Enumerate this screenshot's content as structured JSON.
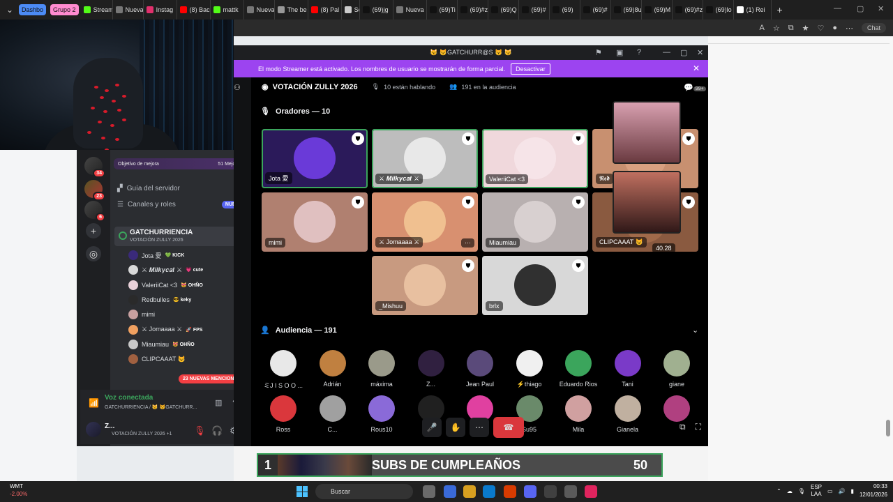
{
  "browser": {
    "tabs": [
      {
        "label": "Dashbo",
        "color": "#4c8bf5",
        "group": true
      },
      {
        "label": "Grupo 2",
        "color": "#ff8bd0",
        "group": true
      },
      {
        "label": "Stream",
        "color": "#53fc18"
      },
      {
        "label": "Nueva",
        "color": "#777777"
      },
      {
        "label": "Instag",
        "color": "#e1306c"
      },
      {
        "label": "(8) Bac",
        "color": "#ff0000"
      },
      {
        "label": "mattk",
        "color": "#53fc18"
      },
      {
        "label": "Nueva",
        "color": "#777777"
      },
      {
        "label": "The be",
        "color": "#999999"
      },
      {
        "label": "(8) Pal",
        "color": "#ff0000"
      },
      {
        "label": "Sc",
        "color": "#cccccc"
      },
      {
        "label": "(69)jg",
        "color": "#111111"
      },
      {
        "label": "Nueva",
        "color": "#777777"
      },
      {
        "label": "(69)Ti",
        "color": "#111111"
      },
      {
        "label": "(69)#z",
        "color": "#111111"
      },
      {
        "label": "(69)Q",
        "color": "#111111"
      },
      {
        "label": "(69)#",
        "color": "#111111"
      },
      {
        "label": "(69)",
        "color": "#111111"
      },
      {
        "label": "(69)#",
        "color": "#111111"
      },
      {
        "label": "(69)8u",
        "color": "#111111"
      },
      {
        "label": "(69)M",
        "color": "#111111"
      },
      {
        "label": "(69)#z",
        "color": "#111111"
      },
      {
        "label": "(69)lo",
        "color": "#111111"
      },
      {
        "label": "(1) Rei",
        "color": "#ffffff"
      }
    ],
    "chat_label": "Chat"
  },
  "sidebar": {
    "boost_label": "Objetivo de mejora",
    "boost_count": "51 Mejoras",
    "guild_badges": [
      "34",
      "23",
      "6"
    ],
    "channels": [
      {
        "label": "Guía del servidor",
        "icon": "guide-icon"
      },
      {
        "label": "Canales y roles",
        "icon": "list-icon",
        "badge": "NUEVO"
      }
    ],
    "voice_channel": {
      "name": "GATCHURRIENCIA",
      "sub": "VOTACIÓN ZULLY 2026"
    },
    "voice_users": [
      {
        "name": "Jota 愛",
        "tag": "💚 KICK",
        "color": "#3a2a7a"
      },
      {
        "name": "⚔ 𝑴𝒊𝒍𝒌𝒚𝒄𝒂𝒕 ⚔",
        "tag": "💗 cute",
        "color": "#d8d8d8"
      },
      {
        "name": "ValeriiCat <3",
        "tag": "😻 OHÑO",
        "color": "#e8d0d8"
      },
      {
        "name": "Redbulles",
        "tag": "😎 keky",
        "color": "#2a2a2a"
      },
      {
        "name": "mimi",
        "tag": "",
        "color": "#c8a0a0"
      },
      {
        "name": "⚔ Jomaaaa ⚔",
        "tag": "🚀 FPS",
        "color": "#f0a060"
      },
      {
        "name": "Miaumiau",
        "tag": "😻 OHÑO",
        "color": "#c8c8c8"
      },
      {
        "name": "CLIPCAAAT 😾",
        "tag": "",
        "color": "#a06040"
      }
    ],
    "mentions": "23 NUEVAS MENCIONES",
    "voice_status": "Voz conectada",
    "voice_where": "GATCHURRIENCIA / 😼 😾GATCHURR...",
    "user_name": "Z...",
    "user_status": "VOTACIÓN ZULLY 2026 +1"
  },
  "stage": {
    "window_title": "😼 😾GATCHURR@S 😾 😼",
    "streamer_text": "El modo Streamer está activado. Los nombres de usuario se mostrarán de forma parcial.",
    "streamer_button": "Desactivar",
    "event_title": "VOTACIÓN ZULLY 2026",
    "speaking_count": "10 están hablando",
    "audience_count": "191 en la audiencia",
    "notif_badge": "99+",
    "speakers_header": "Oradores — 10",
    "audience_header": "Audiencia — 191",
    "facecam_value": "40.28",
    "speakers": [
      {
        "name": "Jota 愛",
        "bg": "#2b1a5a",
        "circle": "#6a3ad8",
        "speaking": true
      },
      {
        "name": "⚔ 𝑴𝒊𝒍𝒌𝒚𝒄𝒂𝒕 ⚔",
        "bg": "#bdbdbd",
        "circle": "#e8e8e8",
        "speaking": true
      },
      {
        "name": "ValeriiCat <3",
        "bg": "#f0d8dc",
        "circle": "#f6e4e8",
        "speaking": true
      },
      {
        "name": "𝕽𝖊𝖉",
        "bg": "#c89070",
        "circle": "#d8a080",
        "speaking": false
      },
      {
        "name": "mimi",
        "bg": "#b08070",
        "circle": "#e0c0c0",
        "speaking": false
      },
      {
        "name": "⚔ Jomaaaa ⚔",
        "bg": "#d89070",
        "circle": "#f0c090",
        "speaking": false
      },
      {
        "name": "Miaumiau",
        "bg": "#b8b0b0",
        "circle": "#d8d0d0",
        "speaking": false
      },
      {
        "name": "CLIPCAAAT 😾",
        "bg": "#8a5a40",
        "circle": "#a06a4a",
        "speaking": false
      },
      {
        "name": "_Mishuu",
        "bg": "#c89a80",
        "circle": "#e8c0a0",
        "speaking": false
      },
      {
        "name": "brlx",
        "bg": "#d8d8d8",
        "circle": "#303030",
        "speaking": false
      }
    ],
    "audience": [
      {
        "name": "ミJ I S O O ...",
        "color": "#e8e8e8"
      },
      {
        "name": "Adrián",
        "color": "#c08040"
      },
      {
        "name": "máxima",
        "color": "#9a9a8a"
      },
      {
        "name": "Z...",
        "color": "#302040"
      },
      {
        "name": "Jean Paul",
        "color": "#5a4a7a"
      },
      {
        "name": "⚡thiago",
        "color": "#f0f0f0"
      },
      {
        "name": "Eduardo Rios",
        "color": "#3ba55c"
      },
      {
        "name": "Tani",
        "color": "#7a3ac8"
      },
      {
        "name": "giane",
        "color": "#a0b090"
      },
      {
        "name": "Ross",
        "color": "#da373c"
      },
      {
        "name": "C...",
        "color": "#a0a0a0"
      },
      {
        "name": "Rous10",
        "color": "#8a6ad8"
      },
      {
        "name": "",
        "color": "#202020"
      },
      {
        "name": "",
        "color": "#e040a0"
      },
      {
        "name": "Su95",
        "color": "#6a8a6a"
      },
      {
        "name": "Mila",
        "color": "#d0a0a0"
      },
      {
        "name": "Gianela",
        "color": "#c0b0a0"
      },
      {
        "name": "",
        "color": "#b04080"
      }
    ]
  },
  "ticker": {
    "rank": "1",
    "text": "SUBS DE CUMPLEAÑOS",
    "count": "50"
  },
  "taskbar": {
    "stock_name": "WMT",
    "stock_change": "-2.00%",
    "search": "Buscar",
    "lang": "ESP",
    "lang2": "LAA",
    "time": "00:33",
    "date": "12/01/2026"
  }
}
